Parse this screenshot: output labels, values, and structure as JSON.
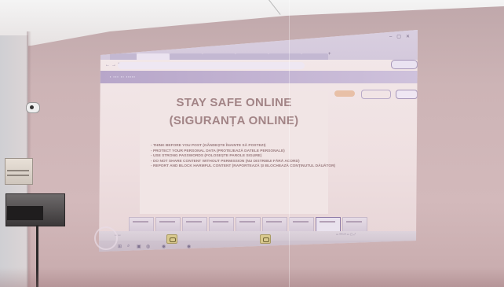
{
  "slide": {
    "title_line1": "STAY SAFE ONLINE",
    "title_line2": "(SIGURANȚA ONLINE)",
    "bullets": [
      "THINK BEFORE YOU POST (GÂNDEȘTE ÎNAINTE SĂ POSTEZI)",
      "PROTECT YOUR PERSONAL DATA (PROTEJEAZĂ DATELE PERSONALE)",
      "USE STRONG PASSWORDS (FOLOSEȘTE PAROLE SIGURE)",
      "DO NOT SHARE CONTENT WITHOUT PERMISSION (NU DISTRIBUI FĂRĂ ACORD)",
      "REPORT AND BLOCK HARMFUL CONTENT (RAPORTEAZĂ ȘI BLOCHEAZĂ CONȚINUTUL DĂUĂTOR)"
    ]
  },
  "colors": {
    "wall": "#cdb4b6",
    "projection": "#efe0e1",
    "title_text": "#a28486",
    "browser_chrome": "#d4c9dc"
  },
  "icons": {
    "camera": "security-camera-icon",
    "ac": "air-conditioner-icon",
    "router": "network-switch-icon"
  }
}
